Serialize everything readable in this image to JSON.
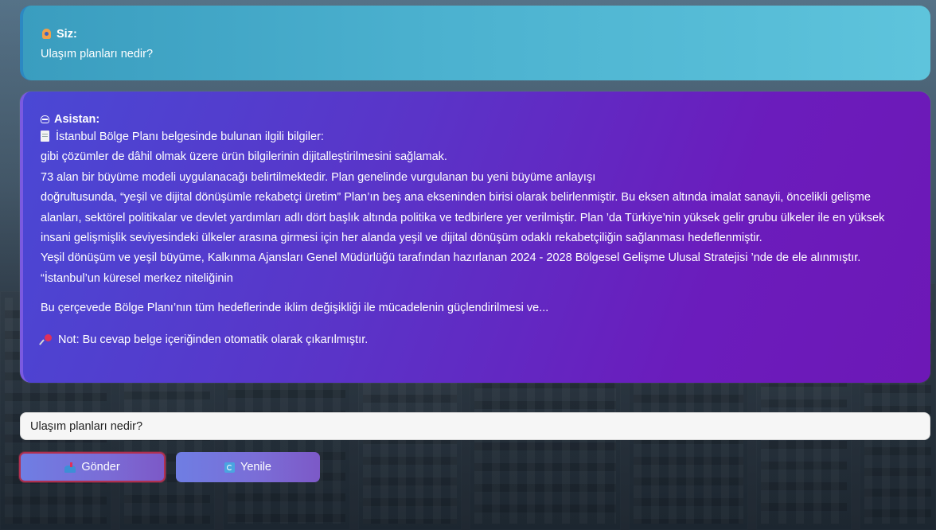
{
  "conversation": {
    "user": {
      "speaker_label": "Siz:",
      "message": "Ulaşım planları nedir?"
    },
    "assistant": {
      "speaker_label": "Asistan:",
      "source_header": "İstanbul Bölge Planı belgesinde bulunan ilgili bilgiler:",
      "lines": [
        "gibi çözümler de dâhil olmak üzere ürün bilgilerinin dijitalleştirilmesini sağlamak.",
        "73 alan bir büyüme modeli uygulanacağı belirtilmektedir. Plan genelinde vurgulanan bu yeni büyüme anlayışı",
        "doğrultusunda, “yeşil ve dijital dönüşümle rekabetçi üretim” Plan’ın beş ana ekseninden birisi olarak belirlenmiştir. Bu eksen altında imalat sanayii, öncelikli gelişme",
        "alanları, sektörel politikalar ve devlet yardımları adlı dört başlık altında politika ve tedbirlere yer verilmiştir. Plan ’da Türkiye’nin yüksek gelir grubu ülkeler ile en yüksek",
        "insani gelişmişlik seviyesindeki ülkeler arasına girmesi için her alanda yeşil ve dijital dönüşüm odaklı rekabetçiliğin sağlanması hedeflenmiştir.",
        "Yeşil dönüşüm ve yeşil büyüme, Kalkınma Ajansları Genel Müdürlüğü tarafından hazırlanan 2024 - 2028 Bölgesel Gelişme Ulusal Stratejisi ’nde de ele alınmıştır.",
        "“İstanbul’un küresel merkez niteliğinin"
      ],
      "summary": "Bu çerçevede Bölge Planı’nın tüm hedeflerinde iklim değişikliği ile mücadelenin güçlendirilmesi ve...",
      "note": "Not: Bu cevap belge içeriğinden otomatik olarak çıkarılmıştır."
    }
  },
  "input": {
    "value": "Ulaşım planları nedir?"
  },
  "buttons": {
    "send_label": "Gönder",
    "refresh_label": "Yenile"
  },
  "icons": {
    "user": "person-icon",
    "assistant": "robot-icon",
    "source": "document-icon",
    "note": "pushpin-icon",
    "send": "mailbox-icon",
    "refresh": "refresh-icon"
  },
  "colors": {
    "user_bubble": "#4bb1cf",
    "assistant_bubble": "#5a34c8",
    "button": "#7b6cd6",
    "send_border": "#b03050"
  }
}
